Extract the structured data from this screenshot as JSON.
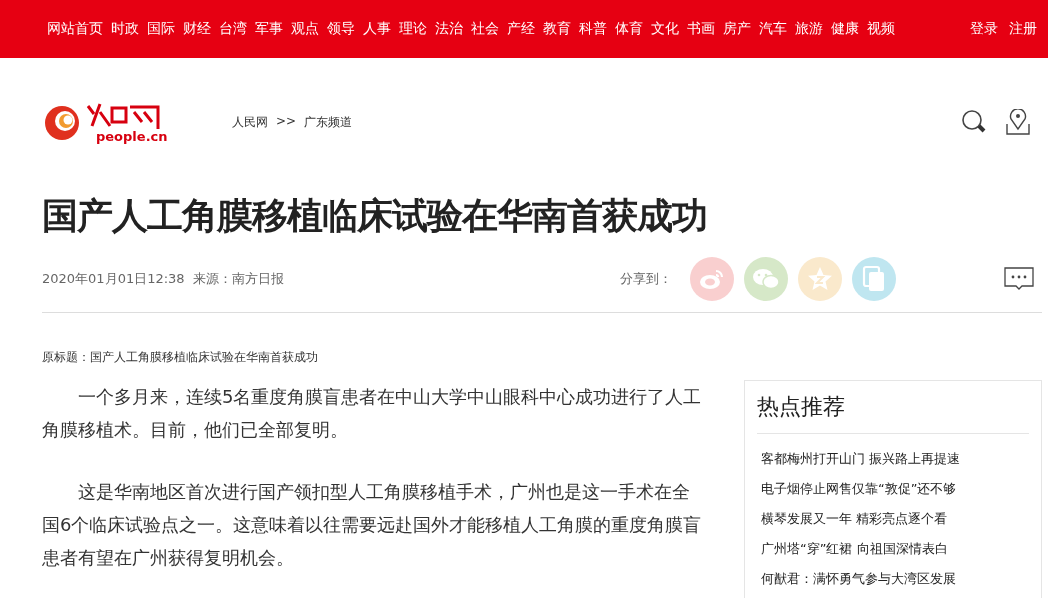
{
  "top_nav": {
    "items": [
      "网站首页",
      "时政",
      "国际",
      "财经",
      "台湾",
      "军事",
      "观点",
      "领导",
      "人事",
      "理论",
      "法治",
      "社会",
      "产经",
      "教育",
      "科普",
      "体育",
      "文化",
      "书画",
      "房产",
      "汽车",
      "旅游",
      "健康",
      "视频"
    ],
    "account": [
      "登录",
      "注册"
    ]
  },
  "header": {
    "logo_text": "people.cn",
    "breadcrumb": [
      "人民网",
      ">>",
      "广东频道"
    ]
  },
  "article": {
    "title": "国产人工角膜移植临床试验在华南首获成功",
    "date": "2020年01月01日12:38",
    "source": "来源：南方日报",
    "share_label": "分享到：",
    "share_buttons": [
      {
        "kind": "weibo",
        "color": "#f9cfcf"
      },
      {
        "kind": "wechat",
        "color": "#d6e8c8"
      },
      {
        "kind": "qzone",
        "color": "#fae9cc"
      },
      {
        "kind": "copy",
        "color": "#bfe6f0"
      }
    ],
    "original_title": "原标题：国产人工角膜移植临床试验在华南首获成功",
    "paragraphs": [
      "一个多月来，连续5名重度角膜盲患者在中山大学中山眼科中心成功进行了人工角膜移植术。目前，他们已全部复明。",
      "这是华南地区首次进行国产领扣型人工角膜移植手术，广州也是这一手术在全国6个临床试验点之一。这意味着以往需要远赴国外才能移植人工角膜的重度角膜盲患者有望在广州获得复明机会。"
    ]
  },
  "sidebar": {
    "title": "热点推荐",
    "items": [
      "客都梅州打开山门 振兴路上再提速",
      "电子烟停止网售仅靠“敦促”还不够",
      "横琴发展又一年 精彩亮点逐个看",
      "广州塔“穿”红裙 向祖国深情表白",
      "何猷君：满怀勇气参与大湾区发展"
    ]
  }
}
